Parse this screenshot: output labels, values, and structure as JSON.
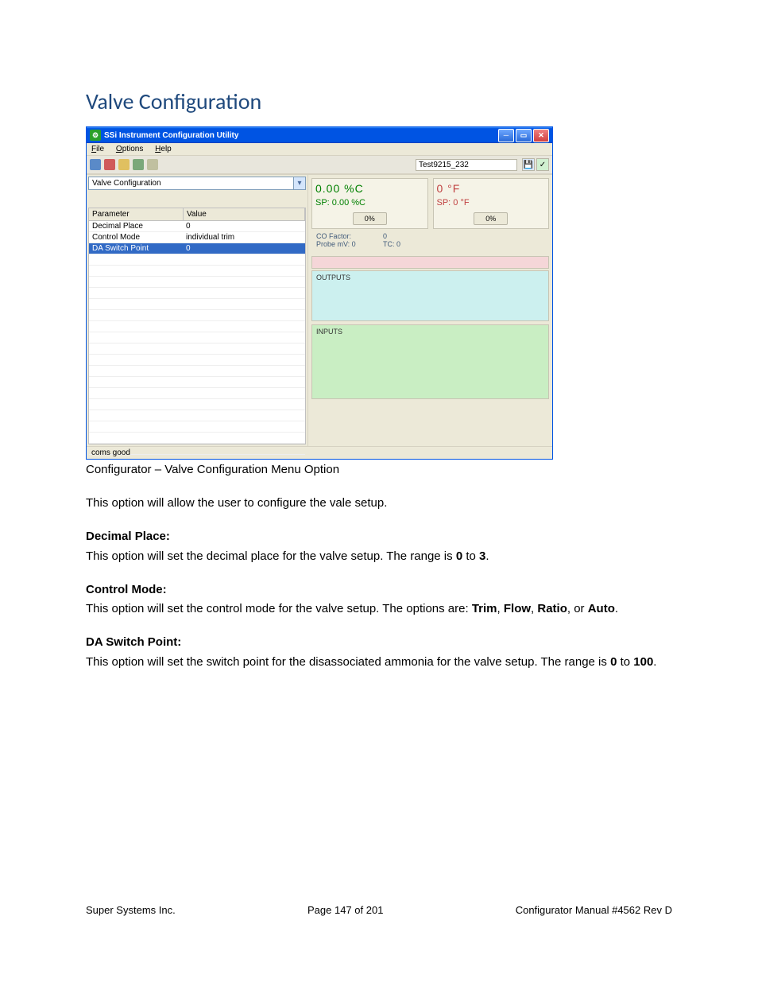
{
  "page_title": "Valve Configuration",
  "caption": "Configurator – Valve Configuration Menu Option",
  "intro": "This option will allow the user to configure the vale setup.",
  "sections": [
    {
      "heading": "Decimal Place:",
      "body_parts": [
        "This option will set the decimal place for the valve setup.  The range is ",
        "0",
        " to ",
        "3",
        "."
      ]
    },
    {
      "heading": "Control Mode:",
      "body_parts": [
        "This option will set the control mode for the valve setup.  The options are:  ",
        "Trim",
        ", ",
        "Flow",
        ", ",
        "Ratio",
        ", or ",
        "Auto",
        "."
      ]
    },
    {
      "heading": "DA Switch Point:",
      "body_parts": [
        "This option will set the switch point for the disassociated ammonia for the valve setup.   The range is ",
        "0",
        " to ",
        "100",
        "."
      ]
    }
  ],
  "footer": {
    "left": "Super Systems Inc.",
    "center": "Page 147 of 201",
    "right": "Configurator Manual #4562 Rev D"
  },
  "window": {
    "title": "SSi Instrument Configuration Utility",
    "menu": {
      "file": "File",
      "options": "Options",
      "help": "Help"
    },
    "toolbar_label": "Test9215_232",
    "combo_value": "Valve Configuration",
    "table": {
      "col1": "Parameter",
      "col2": "Value",
      "rows": [
        {
          "param": "Decimal Place",
          "value": "0"
        },
        {
          "param": "Control Mode",
          "value": "individual trim"
        },
        {
          "param": "DA Switch Point",
          "value": "0",
          "selected": true
        }
      ]
    },
    "display": {
      "c_big": "0.00 %C",
      "c_sp": "SP: 0.00 %C",
      "c_btn": "0%",
      "f_big": "0 °F",
      "f_sp": "SP: 0 °F",
      "f_btn": "0%"
    },
    "info": {
      "l1a": "CO Factor:",
      "l1b": "0",
      "l2a": "Probe mV: 0",
      "l2b": "TC: 0"
    },
    "outputs_label": "OUTPUTS",
    "inputs_label": "INPUTS",
    "status": "coms good"
  }
}
